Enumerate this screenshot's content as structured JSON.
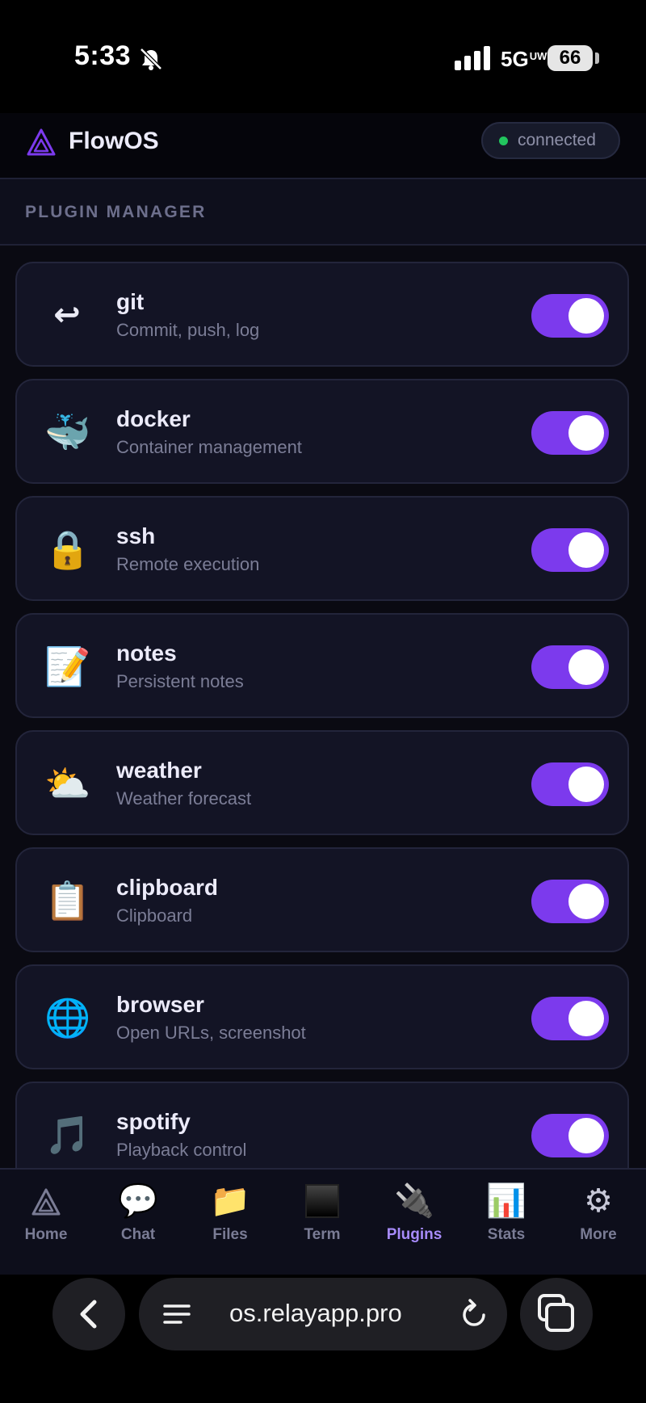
{
  "status": {
    "time": "5:33",
    "network": "5G",
    "network_suffix": "UW",
    "battery": "66"
  },
  "header": {
    "app_name": "FlowOS",
    "connection_label": "connected",
    "connection_color": "#22c55e"
  },
  "section_title": "PLUGIN MANAGER",
  "plugins": [
    {
      "name": "git",
      "desc": "Commit, push, log",
      "icon": "return-arrow-icon",
      "glyph": "↩",
      "enabled": true
    },
    {
      "name": "docker",
      "desc": "Container management",
      "icon": "whale-icon",
      "glyph": "🐳",
      "enabled": true
    },
    {
      "name": "ssh",
      "desc": "Remote execution",
      "icon": "lock-icon",
      "glyph": "🔒",
      "enabled": true
    },
    {
      "name": "notes",
      "desc": "Persistent notes",
      "icon": "memo-icon",
      "glyph": "📝",
      "enabled": true
    },
    {
      "name": "weather",
      "desc": "Weather forecast",
      "icon": "sun-behind-cloud-icon",
      "glyph": "⛅",
      "enabled": true
    },
    {
      "name": "clipboard",
      "desc": "Clipboard",
      "icon": "clipboard-icon",
      "glyph": "📋",
      "enabled": true
    },
    {
      "name": "browser",
      "desc": "Open URLs, screenshot",
      "icon": "globe-icon",
      "glyph": "🌐",
      "enabled": true
    },
    {
      "name": "spotify",
      "desc": "Playback control",
      "icon": "music-note-icon",
      "glyph": "🎵",
      "enabled": true
    }
  ],
  "tabs": [
    {
      "label": "Home",
      "icon": "triangle-logo-icon",
      "glyph": "◬",
      "active": false
    },
    {
      "label": "Chat",
      "icon": "speech-bubble-icon",
      "glyph": "💬",
      "active": false
    },
    {
      "label": "Files",
      "icon": "folder-icon",
      "glyph": "📁",
      "active": false
    },
    {
      "label": "Term",
      "icon": "terminal-icon",
      "glyph": "",
      "active": false
    },
    {
      "label": "Plugins",
      "icon": "plug-icon",
      "glyph": "🔌",
      "active": true
    },
    {
      "label": "Stats",
      "icon": "bar-chart-icon",
      "glyph": "📊",
      "active": false
    },
    {
      "label": "More",
      "icon": "gear-icon",
      "glyph": "⚙",
      "active": false
    }
  ],
  "browser": {
    "url": "os.relayapp.pro"
  },
  "colors": {
    "accent": "#7c3aed",
    "active_tab": "#a78bfa",
    "background": "#0a0a12",
    "card": "#131425"
  }
}
